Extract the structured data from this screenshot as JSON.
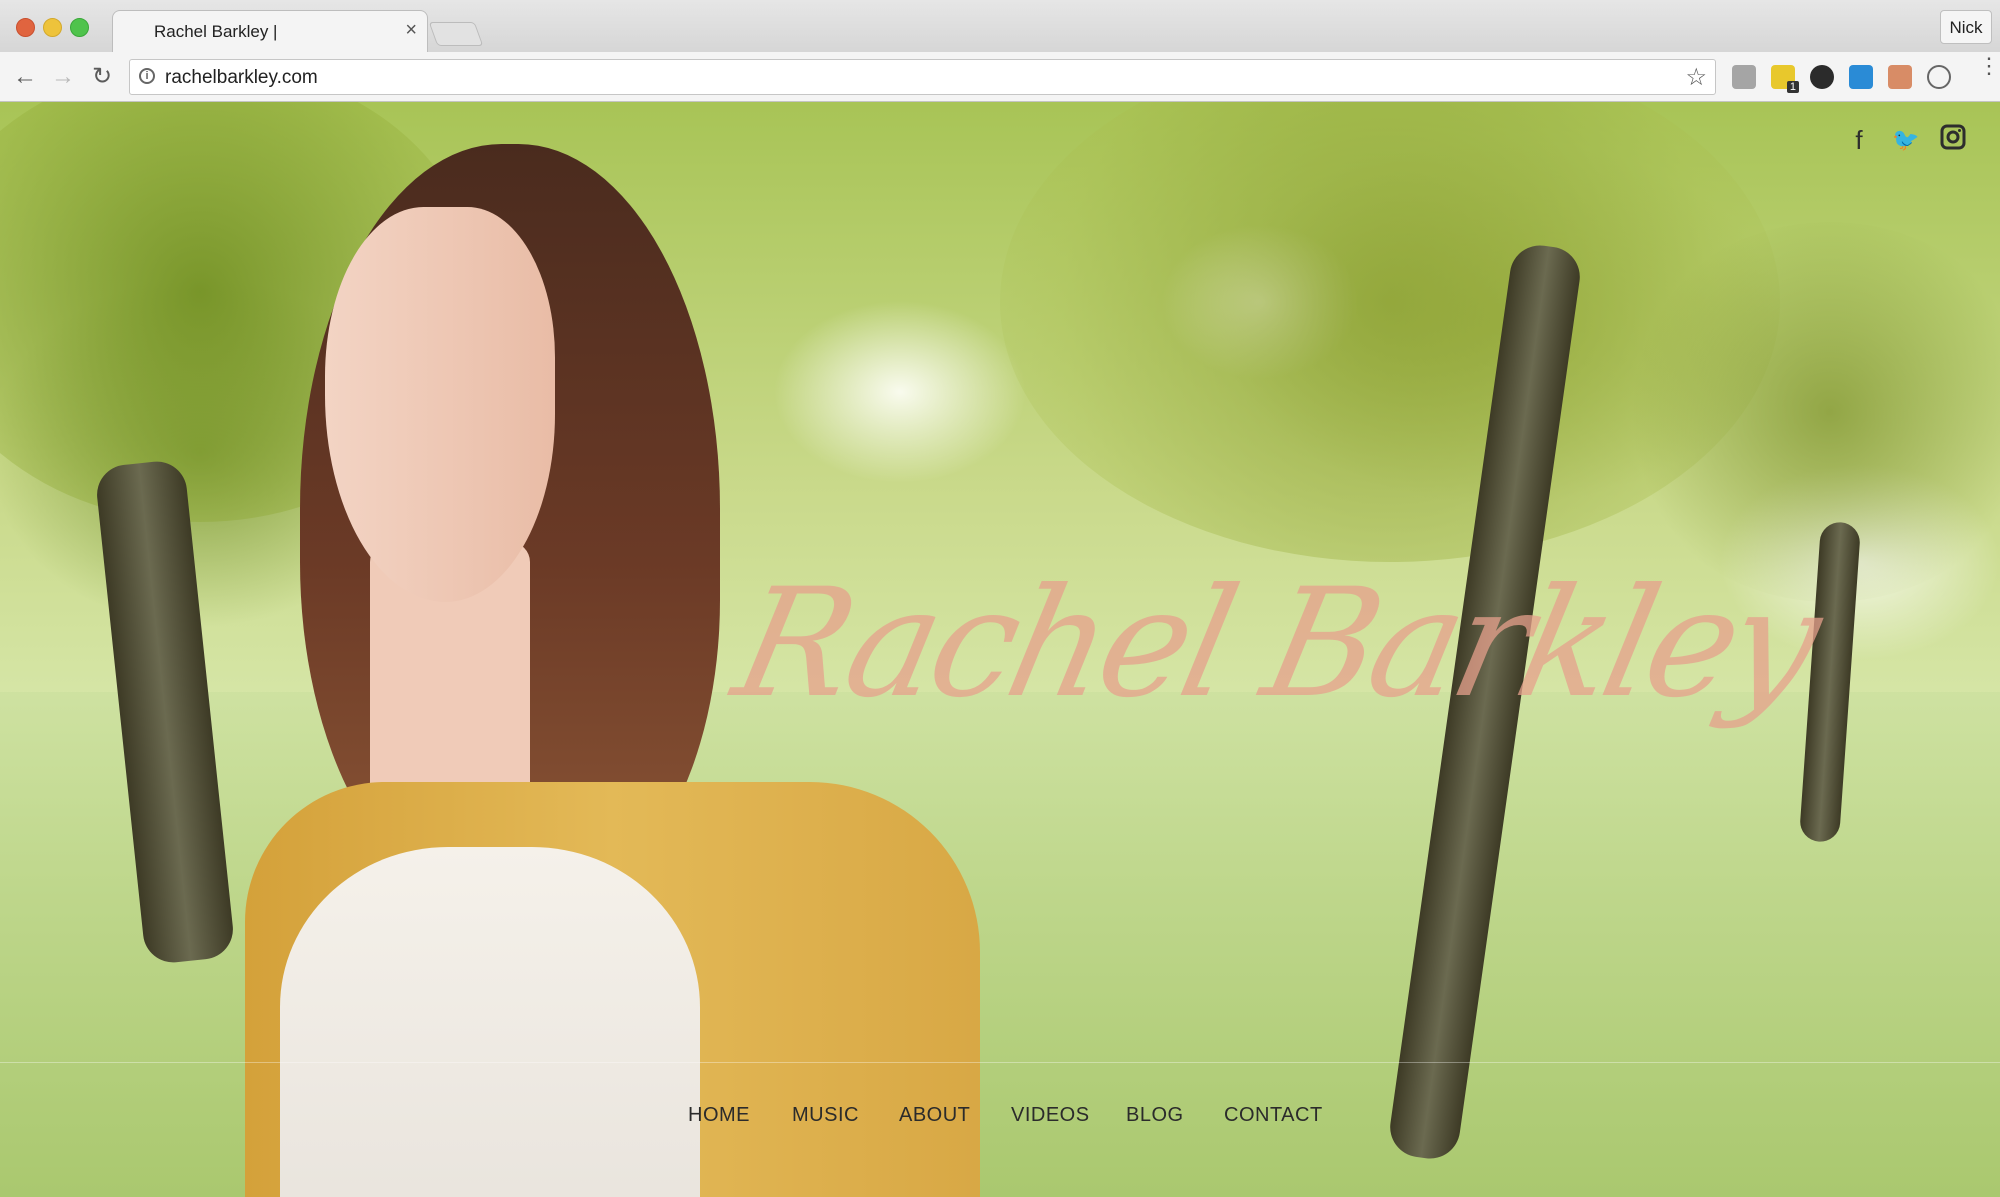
{
  "browser": {
    "tab_title": "Rachel Barkley |",
    "tab_close": "×",
    "profile_name": "Nick",
    "url": "rachelbarkley.com",
    "back_icon": "←",
    "forward_icon": "→",
    "reload_icon": "↻",
    "info_icon": "i",
    "star_icon": "☆",
    "menu_icon": "⋮",
    "extensions": [
      {
        "name": "extension-gray",
        "color": "#9a9a9a"
      },
      {
        "name": "extension-yellow",
        "color": "#e8c82c",
        "badge": "1"
      },
      {
        "name": "extension-camera",
        "color": "#2b2b2b"
      },
      {
        "name": "extension-blue",
        "color": "#2a8bd6"
      },
      {
        "name": "extension-pocket",
        "color": "#d88c66"
      },
      {
        "name": "extension-sync",
        "color": "#666666"
      }
    ]
  },
  "site": {
    "logo_text": "Rachel Barkley",
    "social": {
      "facebook_icon": "f",
      "twitter_icon": "🐦",
      "instagram_icon": "◻"
    },
    "nav": [
      "HOME",
      "MUSIC",
      "ABOUT",
      "VIDEOS",
      "BLOG",
      "CONTACT"
    ]
  }
}
